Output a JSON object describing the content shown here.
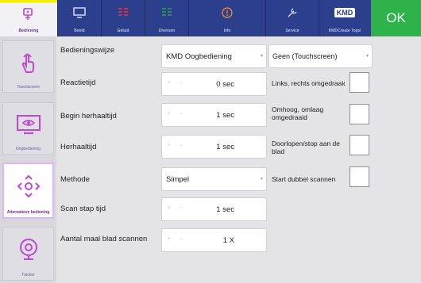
{
  "tabs": [
    {
      "label": "Bediening",
      "icon": "remote-control-icon",
      "active": true
    },
    {
      "label": "Beeld",
      "icon": "monitor-icon",
      "active": false
    },
    {
      "label": "Geluid",
      "icon": "sound-bars-icon",
      "active": false
    },
    {
      "label": "Diversen",
      "icon": "grid-icon",
      "active": false
    },
    {
      "label": "Info",
      "icon": "info-icon",
      "active": false
    },
    {
      "label": "Service",
      "icon": "wrench-icon",
      "active": false
    },
    {
      "label": "KMDCreate Togsi",
      "badge": "KMD",
      "icon": "kmd-logo-icon",
      "active": false
    }
  ],
  "ok_label": "OK",
  "sidebar": [
    {
      "label": "Touchscreen",
      "icon": "hand-pointer-icon",
      "active": false
    },
    {
      "label": "Oogbediening",
      "icon": "eye-screen-icon",
      "active": false
    },
    {
      "label": "Alternatieve bediening",
      "icon": "direction-arrows-icon",
      "active": true
    },
    {
      "label": "Tracker",
      "icon": "webcam-icon",
      "active": false
    }
  ],
  "settings": [
    {
      "label": "Bedieningswijze",
      "type": "select",
      "value": "KMD Oogbediening"
    },
    {
      "label": "Reactietijd",
      "type": "stepper",
      "value": "0 sec"
    },
    {
      "label": "Begin herhaaltijd",
      "type": "stepper",
      "value": "1 sec"
    },
    {
      "label": "Herhaaltijd",
      "type": "stepper",
      "value": "1 sec"
    },
    {
      "label": "Methode",
      "type": "select",
      "value": "Simpel"
    },
    {
      "label": "Scan stap tijd",
      "type": "stepper",
      "value": "1 sec"
    },
    {
      "label": "Aantal maal blad scannen",
      "type": "stepper",
      "value": "1 X"
    }
  ],
  "stepper_symbols": "+ −",
  "right_select": {
    "value": "Geen (Touchscreen)"
  },
  "checkboxes": [
    {
      "label": "Links, rechts omgedraaid",
      "checked": false
    },
    {
      "label": "Omhoog, omlaag omgedraaid",
      "checked": false
    },
    {
      "label": "Doorlopen/stop aan de blad",
      "checked": false
    },
    {
      "label": "Start dubbel scannen",
      "checked": false
    }
  ],
  "colors": {
    "topbar": "#2c3f8c",
    "ok": "#2eb34a",
    "accent": "#6b2f8f",
    "active_tab_border": "#f2f000"
  }
}
